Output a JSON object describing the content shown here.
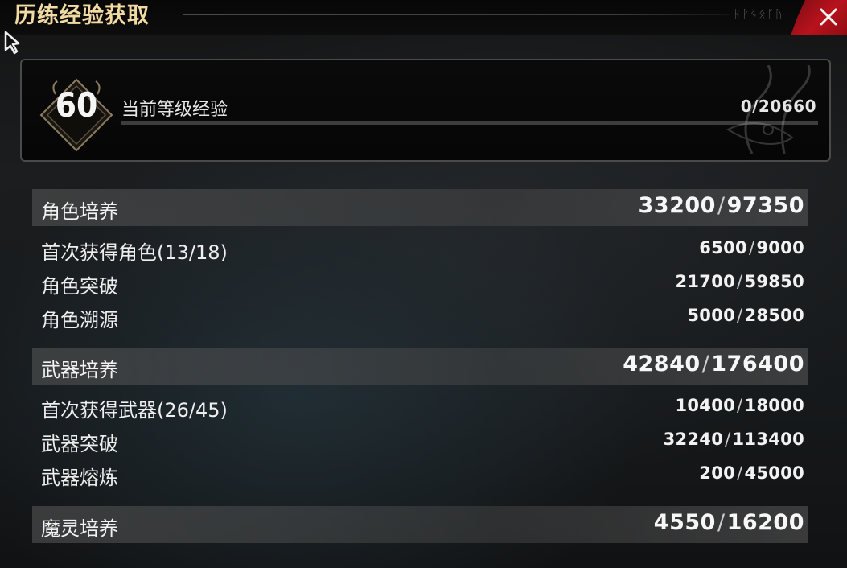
{
  "header": {
    "title": "历练经验获取",
    "rune_text": "ᚺᚹᛃᛟᚴᚢ"
  },
  "level": {
    "number": "60",
    "label": "当前等级经验",
    "value": "0/20660",
    "progress_fraction": 0
  },
  "sections": [
    {
      "name": "角色培养",
      "current": "33200",
      "total": "97350",
      "items": [
        {
          "name": "首次获得角色(13/18)",
          "current": "6500",
          "total": "9000"
        },
        {
          "name": "角色突破",
          "current": "21700",
          "total": "59850"
        },
        {
          "name": "角色溯源",
          "current": "5000",
          "total": "28500"
        }
      ]
    },
    {
      "name": "武器培养",
      "current": "42840",
      "total": "176400",
      "items": [
        {
          "name": "首次获得武器(26/45)",
          "current": "10400",
          "total": "18000"
        },
        {
          "name": "武器突破",
          "current": "32240",
          "total": "113400"
        },
        {
          "name": "武器熔炼",
          "current": "200",
          "total": "45000"
        }
      ]
    },
    {
      "name": "魔灵培养",
      "current": "4550",
      "total": "16200",
      "items": []
    }
  ],
  "separator": "/",
  "colors": {
    "title": "#f2dba2",
    "close_button": "#b8121c"
  },
  "icons": {
    "close": "close-icon",
    "cursor": "cursor-icon",
    "level_badge": "level-badge-icon"
  }
}
